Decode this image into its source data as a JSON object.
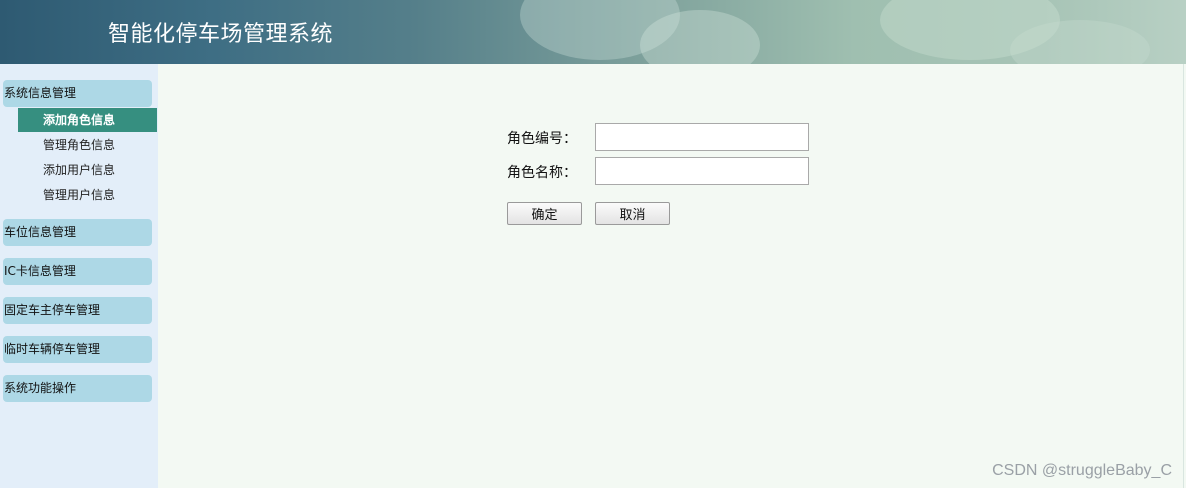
{
  "header": {
    "title": "智能化停车场管理系统"
  },
  "sidebar": {
    "groups": [
      {
        "label": "系统信息管理",
        "items": [
          {
            "label": "添加角色信息",
            "active": true
          },
          {
            "label": "管理角色信息"
          },
          {
            "label": "添加用户信息"
          },
          {
            "label": "管理用户信息"
          }
        ]
      },
      {
        "label": "车位信息管理"
      },
      {
        "label": "IC卡信息管理"
      },
      {
        "label": "固定车主停车管理"
      },
      {
        "label": "临时车辆停车管理"
      },
      {
        "label": "系统功能操作"
      }
    ]
  },
  "form": {
    "role_id_label": "角色编号：",
    "role_id_value": "",
    "role_name_label": "角色名称：",
    "role_name_value": "",
    "confirm_label": "确定",
    "cancel_label": "取消"
  },
  "watermark": "CSDN @struggleBaby_C",
  "colors": {
    "sidebar_bg": "#e3eef9",
    "group_bg": "#add8e6",
    "active_item_bg": "#368f80",
    "main_bg": "#f3f9f3"
  }
}
